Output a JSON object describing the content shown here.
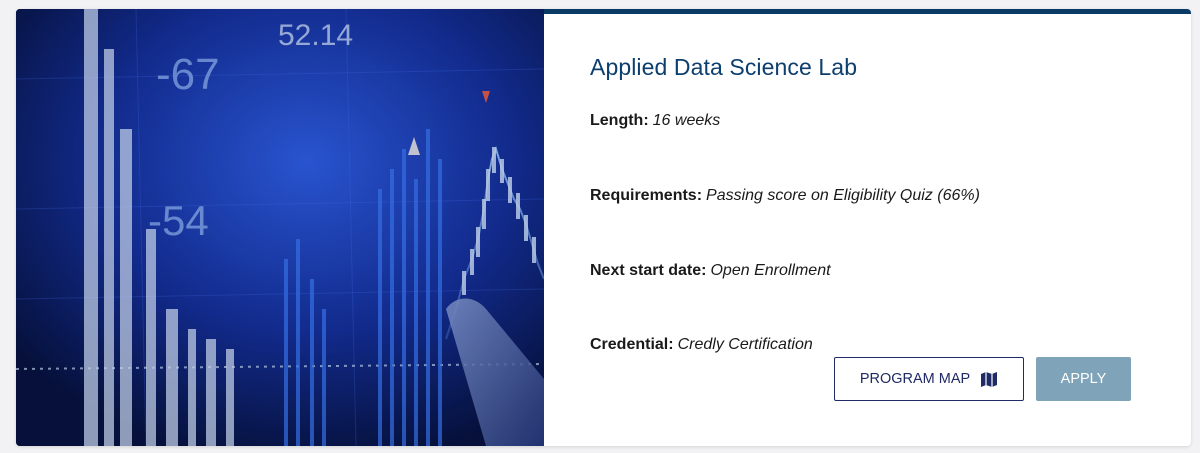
{
  "program": {
    "title": "Applied Data Science Lab",
    "fields": [
      {
        "label": "Length:",
        "value": "16 weeks"
      },
      {
        "label": "Requirements:",
        "value": "Passing score on Eligibility Quiz (66%)"
      },
      {
        "label": "Next start date:",
        "value": "Open Enrollment"
      },
      {
        "label": "Credential:",
        "value": "Credly Certification"
      }
    ]
  },
  "hero": {
    "overlay_numbers": [
      "-67",
      "52.14",
      "-54"
    ],
    "description_icon": "stock-chart-image"
  },
  "actions": {
    "program_map_label": "PROGRAM MAP",
    "program_map_icon": "map-icon",
    "apply_label": "APPLY"
  },
  "colors": {
    "title": "#0c3e6e",
    "accent_bar": "#0a3a66",
    "apply_bg": "#7fa3b8",
    "outline_button": "#1f2a66"
  }
}
